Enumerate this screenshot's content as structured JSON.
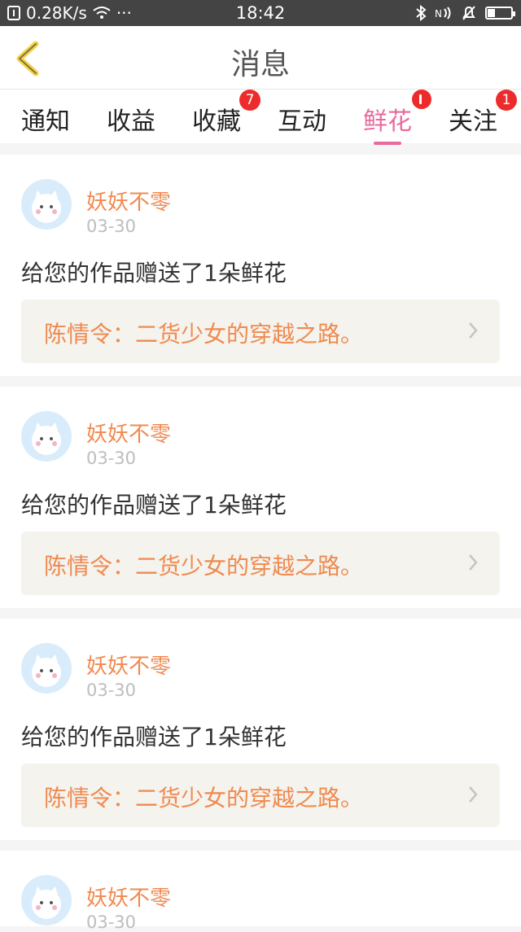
{
  "status_bar": {
    "speed": "0.28K/s",
    "dots": "···",
    "time": "18:42"
  },
  "header": {
    "title": "消息"
  },
  "tabs": [
    {
      "label": "通知",
      "badge": ""
    },
    {
      "label": "收益",
      "badge": ""
    },
    {
      "label": "收藏",
      "badge": "7"
    },
    {
      "label": "互动",
      "badge": ""
    },
    {
      "label": "鲜花",
      "badge": "",
      "active": true
    },
    {
      "label": "关注",
      "badge": "1"
    }
  ],
  "feed": [
    {
      "name": "妖妖不零",
      "date": "03-30",
      "message": "给您的作品赠送了1朵鲜花",
      "work_title": "陈情令：二货少女的穿越之路。"
    },
    {
      "name": "妖妖不零",
      "date": "03-30",
      "message": "给您的作品赠送了1朵鲜花",
      "work_title": "陈情令：二货少女的穿越之路。"
    },
    {
      "name": "妖妖不零",
      "date": "03-30",
      "message": "给您的作品赠送了1朵鲜花",
      "work_title": "陈情令：二货少女的穿越之路。"
    },
    {
      "name": "妖妖不零",
      "date": "03-30"
    }
  ],
  "colors": {
    "accent_pink": "#e96a9d",
    "name_orange": "#f08a50",
    "badge_red": "#ee2b2b",
    "back_yellow": "#f3d24a"
  }
}
